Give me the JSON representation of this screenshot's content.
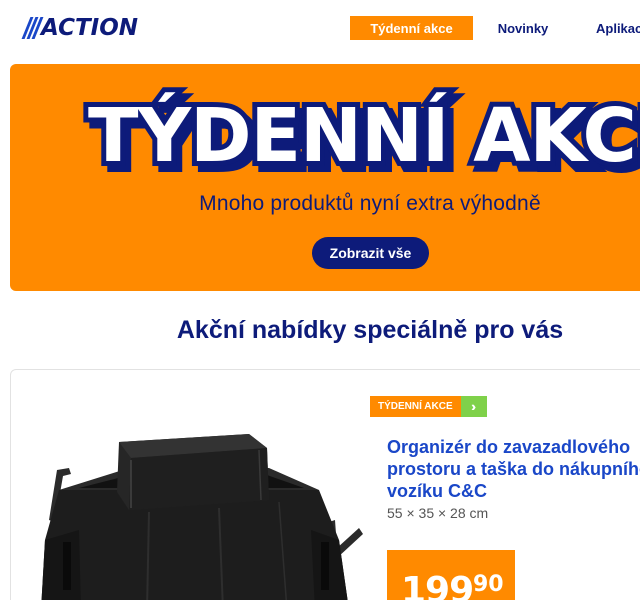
{
  "header": {
    "logo_text": "ACTION",
    "nav": [
      {
        "label": "Týdenní akce",
        "active": true
      },
      {
        "label": "Novinky",
        "active": false
      },
      {
        "label": "Aplikace",
        "active": false
      }
    ]
  },
  "hero": {
    "title": "TÝDENNÍ AKCE",
    "subtitle": "Mnoho produktů nyní extra výhodně",
    "button_label": "Zobrazit vše"
  },
  "section": {
    "title": "Akční nabídky speciálně pro vás"
  },
  "product": {
    "badge_label": "TÝDENNÍ AKCE",
    "badge_icon": "chevrons-right-icon",
    "title": "Organizér do zavazadlového prostoru a taška do nákupního vozíku C&C",
    "dimensions": "55 × 35 × 28 cm",
    "price_main": "199",
    "price_cents": "90"
  },
  "colors": {
    "brand_blue": "#0d1b7a",
    "link_blue": "#1a47c8",
    "accent_orange": "#ff8a00",
    "badge_green": "#7fd14a"
  }
}
